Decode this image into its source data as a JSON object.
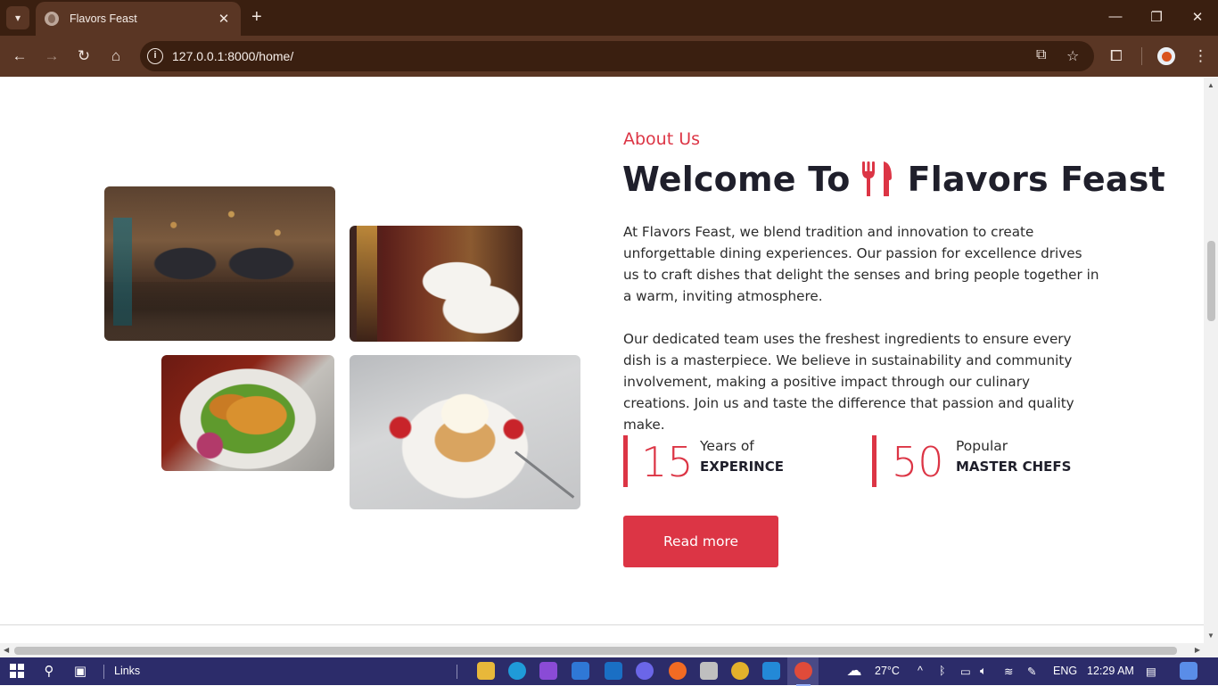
{
  "browser": {
    "tab_title": "Flavors Feast",
    "tab_close": "✕",
    "new_tab": "+",
    "url": "127.0.0.1:8000/home/",
    "window": {
      "minimize": "—",
      "restore": "❐",
      "close": "✕"
    }
  },
  "about": {
    "eyebrow": "About Us",
    "heading_before": "Welcome To",
    "heading_after": "Flavors Feast",
    "paragraph_1": "At Flavors Feast, we blend tradition and innovation to create unforgettable dining experiences. Our passion for excellence drives us to craft dishes that delight the senses and bring people together in a warm, inviting atmosphere.",
    "paragraph_2": "Our dedicated team uses the freshest ingredients to ensure every dish is a masterpiece. We believe in sustainability and community involvement, making a positive impact through our culinary creations. Join us and taste the difference that passion and quality make.",
    "stats": [
      {
        "number": "15",
        "label_top": "Years of",
        "label_bottom": "EXPERINCE"
      },
      {
        "number": "50",
        "label_top": "Popular",
        "label_bottom": "MASTER CHEFS"
      }
    ],
    "button": "Read more"
  },
  "taskbar": {
    "links_label": "Links",
    "weather": "27°C",
    "language": "ENG",
    "time": "12:29 AM"
  },
  "colors": {
    "accent": "#dc3545",
    "heading": "#1f1f2b",
    "chrome_dark": "#3a1f10",
    "chrome_toolbar": "#5a3624",
    "taskbar": "#2c2c6a"
  }
}
